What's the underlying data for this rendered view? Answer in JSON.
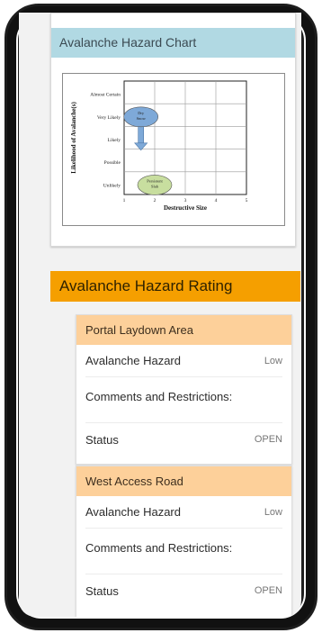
{
  "chart_card": {
    "title": "Avalanche Hazard Chart"
  },
  "chart_data": {
    "type": "scatter",
    "ylabel": "Likelihood of Avalanche(s)",
    "xlabel": "Destructive Size",
    "y_categories": [
      "Unlikely",
      "Possible",
      "Likely",
      "Very Likely",
      "Almost Certain"
    ],
    "x_ticks": [
      "1",
      "2",
      "3",
      "4",
      "5"
    ],
    "xlim": [
      1,
      5
    ],
    "points": [
      {
        "label": "Dry Snow",
        "x": 1.55,
        "y": "Very Likely",
        "color": "#7ea9d8",
        "trend": "down"
      },
      {
        "label": "Persistent Slab",
        "x": 2.0,
        "y": "Unlikely",
        "color": "#c8de9f"
      }
    ],
    "grid": true
  },
  "rating_section": {
    "title": "Avalanche Hazard Rating"
  },
  "areas": [
    {
      "name": "Portal Laydown Area",
      "hazard_label": "Avalanche Hazard",
      "hazard_value": "Low",
      "comments_label": "Comments and Restrictions:",
      "status_label": "Status",
      "status_value": "OPEN"
    },
    {
      "name": "West Access Road",
      "hazard_label": "Avalanche Hazard",
      "hazard_value": "Low",
      "comments_label": "Comments and Restrictions:",
      "status_label": "Status",
      "status_value": "OPEN"
    }
  ],
  "colors": {
    "chart_header": "#b1d9e3",
    "rating_header": "#f59f00",
    "area_header": "#fdd09a"
  }
}
